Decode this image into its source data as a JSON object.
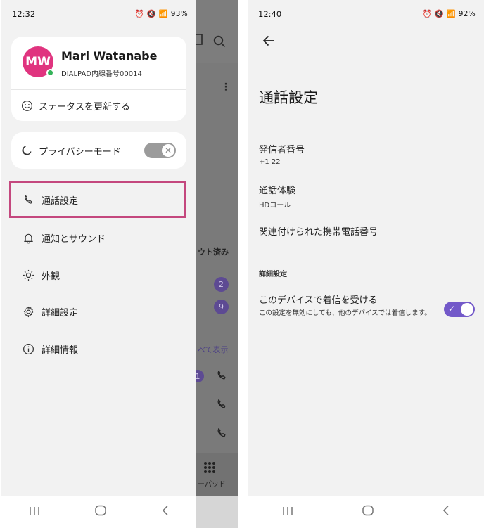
{
  "left": {
    "status_time": "12:32",
    "status_right": "⏰ 🔇 📶 93%",
    "profile": {
      "initials": "MW",
      "name": "Mari Watanabe",
      "subtitle": "DIALPAD内線番号00014",
      "update_status": "ステータスを更新する"
    },
    "privacy_label": "プライバシーモード",
    "menu": [
      {
        "label": "通話設定",
        "icon": "phone-icon"
      },
      {
        "label": "通知とサウンド",
        "icon": "bell-icon"
      },
      {
        "label": "外観",
        "icon": "sun-icon"
      },
      {
        "label": "詳細設定",
        "icon": "gear-icon"
      },
      {
        "label": "詳細情報",
        "icon": "info-icon"
      }
    ],
    "background_app": {
      "section_label": "ウト済み",
      "badge_1": "2",
      "badge_2": "9",
      "see_all": "べて表示",
      "badge_3": "1",
      "keypad_label": "ーパッド"
    }
  },
  "right": {
    "status_time": "12:40",
    "status_right": "⏰ 🔇 📶 92%",
    "title": "通話設定",
    "caller_id": {
      "label": "発信者番号",
      "value": "+1 22"
    },
    "call_experience": {
      "label": "通話体験",
      "value": "HDコール"
    },
    "linked_mobile": "関連付けられた携帯電話番号",
    "advanced_header": "詳細設定",
    "receive_calls": {
      "label": "このデバイスで着信を受ける",
      "description": "この設定を無効にしても、他のデバイスでは着信します。"
    }
  },
  "colors": {
    "accent": "#7359c9",
    "avatar": "#e0347f",
    "selection_border": "#c4487e",
    "presence": "#35b35a"
  }
}
